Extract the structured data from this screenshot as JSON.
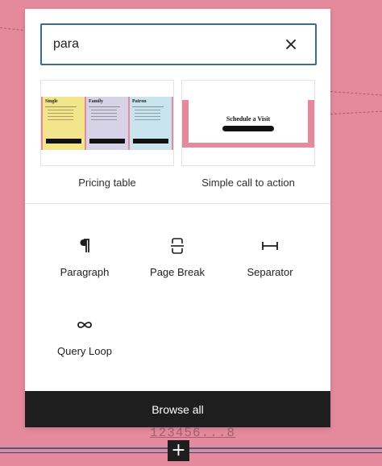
{
  "search": {
    "value": "para",
    "clear_icon": "close-icon"
  },
  "patterns": [
    {
      "title": "Pricing table",
      "preview": {
        "columns": [
          {
            "name": "Single",
            "color": "#f3e58c"
          },
          {
            "name": "Family",
            "color": "#d7d3e6"
          },
          {
            "name": "Patron",
            "color": "#c9e4ec"
          }
        ],
        "band_color": "#e58a9d"
      }
    },
    {
      "title": "Simple call to action",
      "preview": {
        "heading": "Schedule a Visit",
        "band_color": "#e58a9d"
      }
    }
  ],
  "blocks": [
    {
      "label": "Paragraph",
      "icon": "paragraph-icon"
    },
    {
      "label": "Page Break",
      "icon": "page-break-icon"
    },
    {
      "label": "Separator",
      "icon": "separator-icon"
    },
    {
      "label": "Query Loop",
      "icon": "query-loop-icon"
    }
  ],
  "browse_all": "Browse all",
  "inserter_toggle": "+",
  "colors": {
    "canvas": "#e58a9d",
    "panel": "#ffffff",
    "search_border": "#3b6e8e",
    "browse_button": "#1e1e1e"
  }
}
